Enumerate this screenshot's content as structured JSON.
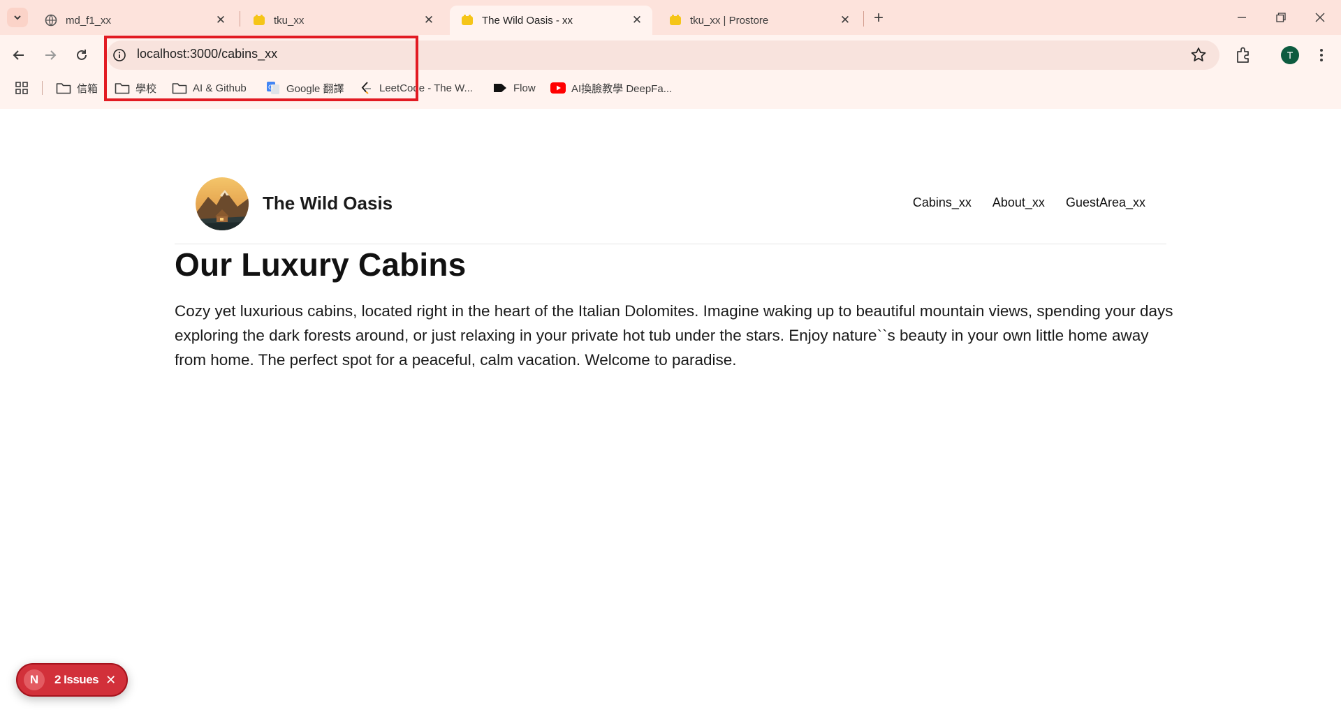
{
  "browser": {
    "tabs": [
      {
        "title": "md_f1_xx",
        "favicon": "globe-icon",
        "active": false
      },
      {
        "title": "tku_xx",
        "favicon": "yellow-app-icon",
        "active": false
      },
      {
        "title": "The Wild Oasis - xx",
        "favicon": "yellow-app-icon",
        "active": true
      },
      {
        "title": "tku_xx | Prostore",
        "favicon": "yellow-app-icon",
        "active": false
      }
    ],
    "new_tab_label": "+",
    "url": "localhost:3000/cabins_xx",
    "profile_initial": "T",
    "bookmarks": [
      {
        "label": "信箱",
        "icon": "folder-icon"
      },
      {
        "label": "學校",
        "icon": "folder-icon"
      },
      {
        "label": "AI & Github",
        "icon": "folder-icon"
      },
      {
        "label": "Google 翻譯",
        "icon": "google-translate-icon"
      },
      {
        "label": "LeetCode - The W...",
        "icon": "leetcode-icon"
      },
      {
        "label": "Flow",
        "icon": "flow-icon"
      },
      {
        "label": "AI換臉教學 DeepFa...",
        "icon": "youtube-icon"
      }
    ],
    "colors": {
      "tabstrip": "#fde3dc",
      "toolbar": "#fff3ef",
      "highlight": "#e21b23"
    }
  },
  "site": {
    "brand": "The Wild Oasis",
    "nav": [
      "Cabins_xx",
      "About_xx",
      "GuestArea_xx"
    ],
    "heading": "Our Luxury Cabins",
    "intro": "Cozy yet luxurious cabins, located right in the heart of the Italian Dolomites. Imagine waking up to beautiful mountain views, spending your days exploring the dark forests around, or just relaxing in your private hot tub under the stars. Enjoy nature``s beauty in your own little home away from home. The perfect spot for a peaceful, calm vacation. Welcome to paradise."
  },
  "devtools": {
    "badge_letter": "N",
    "issues_label": "2 Issues"
  }
}
